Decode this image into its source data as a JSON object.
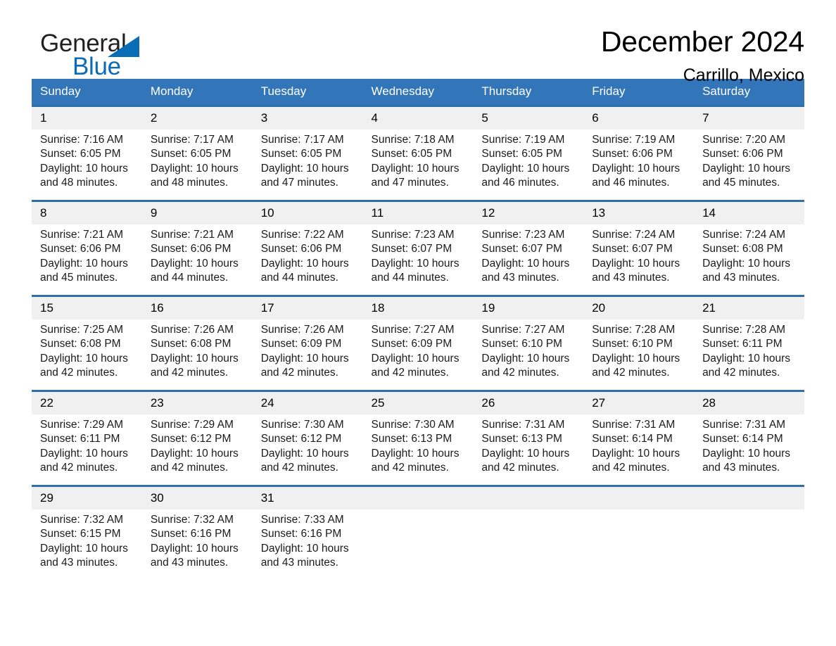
{
  "brand": {
    "word_general": "General",
    "word_blue": "Blue",
    "triangle_color": "#0a6cb4"
  },
  "header": {
    "title": "December 2024",
    "location": "Carrillo, Mexico",
    "accent_color": "#3275b8",
    "row_rule_color": "#2f6fa8",
    "daynum_band_color": "#f0f0f0"
  },
  "weekdays": [
    "Sunday",
    "Monday",
    "Tuesday",
    "Wednesday",
    "Thursday",
    "Friday",
    "Saturday"
  ],
  "weeks": [
    [
      {
        "day": "1",
        "l1": "Sunrise: 7:16 AM",
        "l2": "Sunset: 6:05 PM",
        "l3": "Daylight: 10 hours",
        "l4": "and 48 minutes."
      },
      {
        "day": "2",
        "l1": "Sunrise: 7:17 AM",
        "l2": "Sunset: 6:05 PM",
        "l3": "Daylight: 10 hours",
        "l4": "and 48 minutes."
      },
      {
        "day": "3",
        "l1": "Sunrise: 7:17 AM",
        "l2": "Sunset: 6:05 PM",
        "l3": "Daylight: 10 hours",
        "l4": "and 47 minutes."
      },
      {
        "day": "4",
        "l1": "Sunrise: 7:18 AM",
        "l2": "Sunset: 6:05 PM",
        "l3": "Daylight: 10 hours",
        "l4": "and 47 minutes."
      },
      {
        "day": "5",
        "l1": "Sunrise: 7:19 AM",
        "l2": "Sunset: 6:05 PM",
        "l3": "Daylight: 10 hours",
        "l4": "and 46 minutes."
      },
      {
        "day": "6",
        "l1": "Sunrise: 7:19 AM",
        "l2": "Sunset: 6:06 PM",
        "l3": "Daylight: 10 hours",
        "l4": "and 46 minutes."
      },
      {
        "day": "7",
        "l1": "Sunrise: 7:20 AM",
        "l2": "Sunset: 6:06 PM",
        "l3": "Daylight: 10 hours",
        "l4": "and 45 minutes."
      }
    ],
    [
      {
        "day": "8",
        "l1": "Sunrise: 7:21 AM",
        "l2": "Sunset: 6:06 PM",
        "l3": "Daylight: 10 hours",
        "l4": "and 45 minutes."
      },
      {
        "day": "9",
        "l1": "Sunrise: 7:21 AM",
        "l2": "Sunset: 6:06 PM",
        "l3": "Daylight: 10 hours",
        "l4": "and 44 minutes."
      },
      {
        "day": "10",
        "l1": "Sunrise: 7:22 AM",
        "l2": "Sunset: 6:06 PM",
        "l3": "Daylight: 10 hours",
        "l4": "and 44 minutes."
      },
      {
        "day": "11",
        "l1": "Sunrise: 7:23 AM",
        "l2": "Sunset: 6:07 PM",
        "l3": "Daylight: 10 hours",
        "l4": "and 44 minutes."
      },
      {
        "day": "12",
        "l1": "Sunrise: 7:23 AM",
        "l2": "Sunset: 6:07 PM",
        "l3": "Daylight: 10 hours",
        "l4": "and 43 minutes."
      },
      {
        "day": "13",
        "l1": "Sunrise: 7:24 AM",
        "l2": "Sunset: 6:07 PM",
        "l3": "Daylight: 10 hours",
        "l4": "and 43 minutes."
      },
      {
        "day": "14",
        "l1": "Sunrise: 7:24 AM",
        "l2": "Sunset: 6:08 PM",
        "l3": "Daylight: 10 hours",
        "l4": "and 43 minutes."
      }
    ],
    [
      {
        "day": "15",
        "l1": "Sunrise: 7:25 AM",
        "l2": "Sunset: 6:08 PM",
        "l3": "Daylight: 10 hours",
        "l4": "and 42 minutes."
      },
      {
        "day": "16",
        "l1": "Sunrise: 7:26 AM",
        "l2": "Sunset: 6:08 PM",
        "l3": "Daylight: 10 hours",
        "l4": "and 42 minutes."
      },
      {
        "day": "17",
        "l1": "Sunrise: 7:26 AM",
        "l2": "Sunset: 6:09 PM",
        "l3": "Daylight: 10 hours",
        "l4": "and 42 minutes."
      },
      {
        "day": "18",
        "l1": "Sunrise: 7:27 AM",
        "l2": "Sunset: 6:09 PM",
        "l3": "Daylight: 10 hours",
        "l4": "and 42 minutes."
      },
      {
        "day": "19",
        "l1": "Sunrise: 7:27 AM",
        "l2": "Sunset: 6:10 PM",
        "l3": "Daylight: 10 hours",
        "l4": "and 42 minutes."
      },
      {
        "day": "20",
        "l1": "Sunrise: 7:28 AM",
        "l2": "Sunset: 6:10 PM",
        "l3": "Daylight: 10 hours",
        "l4": "and 42 minutes."
      },
      {
        "day": "21",
        "l1": "Sunrise: 7:28 AM",
        "l2": "Sunset: 6:11 PM",
        "l3": "Daylight: 10 hours",
        "l4": "and 42 minutes."
      }
    ],
    [
      {
        "day": "22",
        "l1": "Sunrise: 7:29 AM",
        "l2": "Sunset: 6:11 PM",
        "l3": "Daylight: 10 hours",
        "l4": "and 42 minutes."
      },
      {
        "day": "23",
        "l1": "Sunrise: 7:29 AM",
        "l2": "Sunset: 6:12 PM",
        "l3": "Daylight: 10 hours",
        "l4": "and 42 minutes."
      },
      {
        "day": "24",
        "l1": "Sunrise: 7:30 AM",
        "l2": "Sunset: 6:12 PM",
        "l3": "Daylight: 10 hours",
        "l4": "and 42 minutes."
      },
      {
        "day": "25",
        "l1": "Sunrise: 7:30 AM",
        "l2": "Sunset: 6:13 PM",
        "l3": "Daylight: 10 hours",
        "l4": "and 42 minutes."
      },
      {
        "day": "26",
        "l1": "Sunrise: 7:31 AM",
        "l2": "Sunset: 6:13 PM",
        "l3": "Daylight: 10 hours",
        "l4": "and 42 minutes."
      },
      {
        "day": "27",
        "l1": "Sunrise: 7:31 AM",
        "l2": "Sunset: 6:14 PM",
        "l3": "Daylight: 10 hours",
        "l4": "and 42 minutes."
      },
      {
        "day": "28",
        "l1": "Sunrise: 7:31 AM",
        "l2": "Sunset: 6:14 PM",
        "l3": "Daylight: 10 hours",
        "l4": "and 43 minutes."
      }
    ],
    [
      {
        "day": "29",
        "l1": "Sunrise: 7:32 AM",
        "l2": "Sunset: 6:15 PM",
        "l3": "Daylight: 10 hours",
        "l4": "and 43 minutes."
      },
      {
        "day": "30",
        "l1": "Sunrise: 7:32 AM",
        "l2": "Sunset: 6:16 PM",
        "l3": "Daylight: 10 hours",
        "l4": "and 43 minutes."
      },
      {
        "day": "31",
        "l1": "Sunrise: 7:33 AM",
        "l2": "Sunset: 6:16 PM",
        "l3": "Daylight: 10 hours",
        "l4": "and 43 minutes."
      },
      {
        "day": "",
        "l1": "",
        "l2": "",
        "l3": "",
        "l4": ""
      },
      {
        "day": "",
        "l1": "",
        "l2": "",
        "l3": "",
        "l4": ""
      },
      {
        "day": "",
        "l1": "",
        "l2": "",
        "l3": "",
        "l4": ""
      },
      {
        "day": "",
        "l1": "",
        "l2": "",
        "l3": "",
        "l4": ""
      }
    ]
  ]
}
